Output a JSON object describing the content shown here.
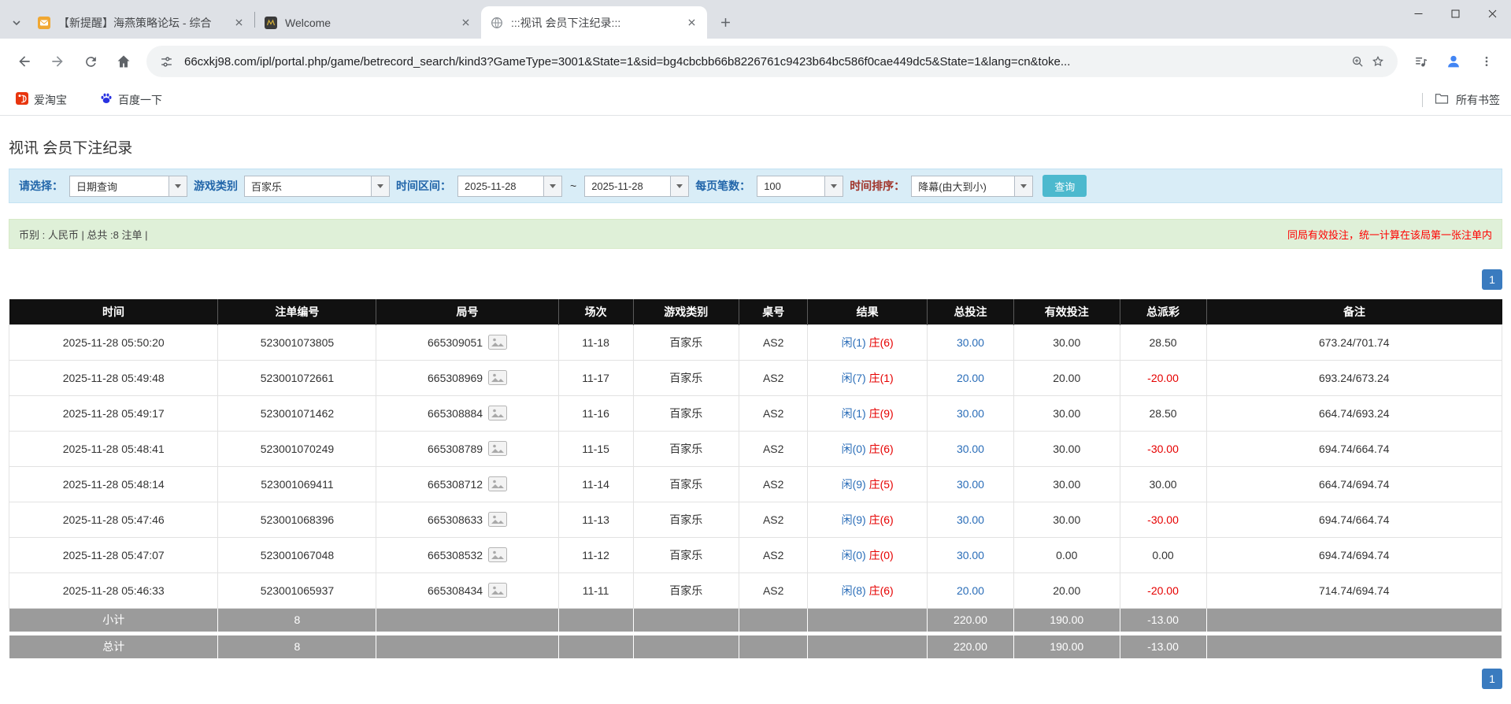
{
  "browser": {
    "tabs": [
      {
        "title": "【新提醒】海燕策略论坛 - 综合",
        "active": false
      },
      {
        "title": "Welcome",
        "active": false
      },
      {
        "title": ":::视讯 会员下注纪录:::",
        "active": true
      }
    ],
    "url": "66cxkj98.com/ipl/portal.php/game/betrecord_search/kind3?GameType=3001&State=1&sid=bg4cbcbb66b8226761c9423b64bc586f0cae449dc5&State=1&lang=cn&toke...",
    "bookmarks": [
      {
        "label": "爱淘宝"
      },
      {
        "label": "百度一下"
      }
    ],
    "all_bookmarks_label": "所有书签"
  },
  "icons": {
    "tab_search": "chevron-down",
    "new_tab": "plus",
    "window_controls": [
      "minimize",
      "maximize",
      "close"
    ],
    "nav": [
      "back-arrow",
      "forward-arrow",
      "refresh",
      "home"
    ],
    "omnibox": [
      "site-info-tune",
      "zoom-magnifier",
      "bookmark-star"
    ],
    "toolbar_right": [
      "media-controls",
      "profile-avatar",
      "menu-dots"
    ],
    "bookmark_favicons": [
      "taobao-red",
      "baidu-paw"
    ],
    "all_bookmarks": "folder",
    "round_cell": "image-thumbnail"
  },
  "colors": {
    "link_blue": "#2a6db8",
    "negative_red": "#e60000",
    "notice_red": "#ff0000",
    "highlight_yellow": "#ffff99",
    "table_header_bg": "#111111",
    "table_footer_bg": "#9b9b9b",
    "filter_bar_bg": "#d9edf7",
    "summary_bar_bg": "#dff0d8",
    "search_button_bg": "#4cb9ce",
    "pagination_bg": "#3a7bbf"
  },
  "page": {
    "title": "视讯 会员下注纪录",
    "filters": {
      "select_label": "请选择：",
      "select_value": "日期查询",
      "game_type_label": "游戏类别",
      "game_type_value": "百家乐",
      "date_range_label": "时间区间：",
      "date_from": "2025-11-28",
      "tilde": "~",
      "date_to": "2025-11-28",
      "page_size_label": "每页笔数：",
      "page_size_value": "100",
      "sort_label": "时间排序：",
      "sort_value": "降幕(由大到小)",
      "search_button": "查询"
    },
    "summary": {
      "left": "币别 : 人民币 | 总共 :8 注单 |",
      "right": "同局有效投注，统一计算在该局第一张注单内"
    },
    "pagination": "1",
    "table": {
      "headers": [
        "时间",
        "注单编号",
        "局号",
        "场次",
        "游戏类别",
        "桌号",
        "结果",
        "总投注",
        "有效投注",
        "总派彩",
        "备注"
      ],
      "rows": [
        {
          "time": "2025-11-28 05:50:20",
          "bet_id": "523001073805",
          "round_id": "665309051",
          "session": "11-18",
          "game": "百家乐",
          "table_no": "AS2",
          "result_player": "闲(1)",
          "result_banker": "庄(6)",
          "total_bet": "30.00",
          "valid_bet": "30.00",
          "payout": "28.50",
          "note": "673.24/701.74"
        },
        {
          "time": "2025-11-28 05:49:48",
          "bet_id": "523001072661",
          "round_id": "665308969",
          "session": "11-17",
          "game": "百家乐",
          "table_no": "AS2",
          "result_player": "闲(7)",
          "result_banker": "庄(1)",
          "total_bet": "20.00",
          "valid_bet": "20.00",
          "payout": "-20.00",
          "note": "693.24/673.24"
        },
        {
          "time": "2025-11-28 05:49:17",
          "bet_id": "523001071462",
          "round_id": "665308884",
          "session": "11-16",
          "game": "百家乐",
          "table_no": "AS2",
          "result_player": "闲(1)",
          "result_banker": "庄(9)",
          "total_bet": "30.00",
          "valid_bet": "30.00",
          "payout": "28.50",
          "note": "664.74/693.24"
        },
        {
          "time": "2025-11-28 05:48:41",
          "bet_id": "523001070249",
          "round_id": "665308789",
          "session": "11-15",
          "game": "百家乐",
          "table_no": "AS2",
          "result_player": "闲(0)",
          "result_banker": "庄(6)",
          "total_bet": "30.00",
          "valid_bet": "30.00",
          "payout": "-30.00",
          "note": "694.74/664.74"
        },
        {
          "time": "2025-11-28 05:48:14",
          "bet_id": "523001069411",
          "round_id": "665308712",
          "session": "11-14",
          "game": "百家乐",
          "table_no": "AS2",
          "result_player": "闲(9)",
          "result_banker": "庄(5)",
          "total_bet": "30.00",
          "valid_bet": "30.00",
          "payout": "30.00",
          "note": "664.74/694.74"
        },
        {
          "time": "2025-11-28 05:47:46",
          "bet_id": "523001068396",
          "round_id": "665308633",
          "session": "11-13",
          "game": "百家乐",
          "table_no": "AS2",
          "result_player": "闲(9)",
          "result_banker": "庄(6)",
          "total_bet": "30.00",
          "valid_bet": "30.00",
          "payout": "-30.00",
          "note": "694.74/664.74"
        },
        {
          "time": "2025-11-28 05:47:07",
          "bet_id": "523001067048",
          "round_id": "665308532",
          "session": "11-12",
          "game": "百家乐",
          "table_no": "AS2",
          "result_player": "闲(0)",
          "result_banker": "庄(0)",
          "total_bet": "30.00",
          "valid_bet": "0.00",
          "payout": "0.00",
          "note": "694.74/694.74"
        },
        {
          "time": "2025-11-28 05:46:33",
          "bet_id": "523001065937",
          "round_id": "665308434",
          "session": "11-11",
          "game": "百家乐",
          "table_no": "AS2",
          "result_player": "闲(8)",
          "result_banker": "庄(6)",
          "total_bet": "20.00",
          "valid_bet": "20.00",
          "payout": "-20.00",
          "note": "714.74/694.74"
        }
      ],
      "subtotal": {
        "label": "小计",
        "count": "8",
        "total_bet": "220.00",
        "valid_bet": "190.00",
        "payout": "-13.00"
      },
      "total": {
        "label": "总计",
        "count": "8",
        "total_bet": "220.00",
        "valid_bet": "190.00",
        "payout": "-13.00"
      }
    }
  }
}
